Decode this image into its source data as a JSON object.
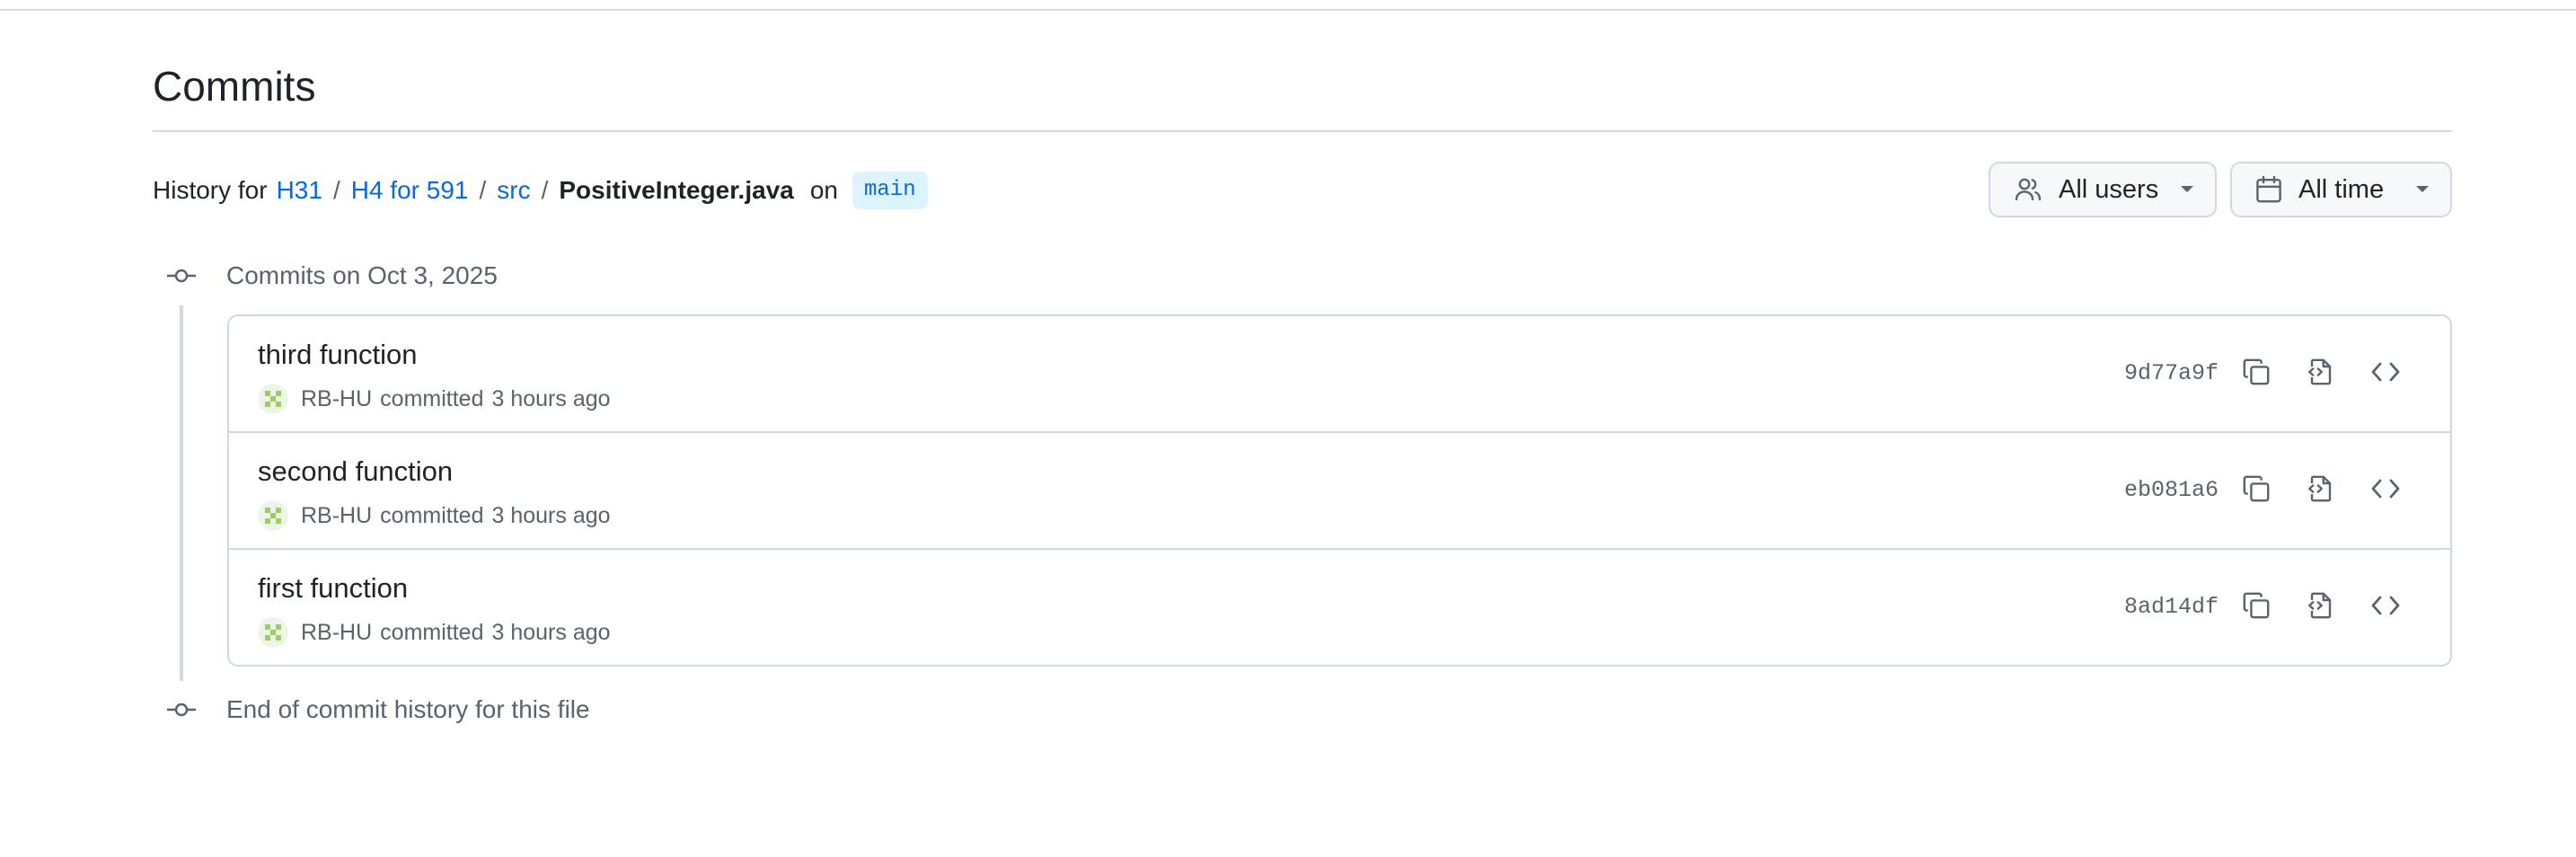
{
  "page": {
    "title": "Commits"
  },
  "history": {
    "prefix": "History for",
    "breadcrumb": [
      "H31",
      "H4 for 591",
      "src"
    ],
    "separator": "/",
    "file": "PositiveInteger.java",
    "on_text": "on",
    "branch": "main"
  },
  "filters": {
    "users_label": "All users",
    "time_label": "All time"
  },
  "timeline": {
    "group_label": "Commits on Oct 3, 2025",
    "end_label": "End of commit history for this file"
  },
  "commits": [
    {
      "message": "third function",
      "author": "RB-HU",
      "action": "committed",
      "time": "3 hours ago",
      "sha": "9d77a9f"
    },
    {
      "message": "second function",
      "author": "RB-HU",
      "action": "committed",
      "time": "3 hours ago",
      "sha": "eb081a6"
    },
    {
      "message": "first function",
      "author": "RB-HU",
      "action": "committed",
      "time": "3 hours ago",
      "sha": "8ad14df"
    }
  ],
  "icons": {
    "users_filter": "people-icon",
    "time_filter": "calendar-icon",
    "dropdown": "triangle-down-icon",
    "timeline": "git-commit-icon",
    "copy": "copy-icon",
    "view_diff": "file-diff-icon",
    "browse": "code-icon"
  },
  "colors": {
    "link": "#0969da",
    "branch_bg": "#ddf4ff",
    "muted_text": "#59636e",
    "border": "#d1d9e0",
    "avatar": "#9ccc65"
  }
}
